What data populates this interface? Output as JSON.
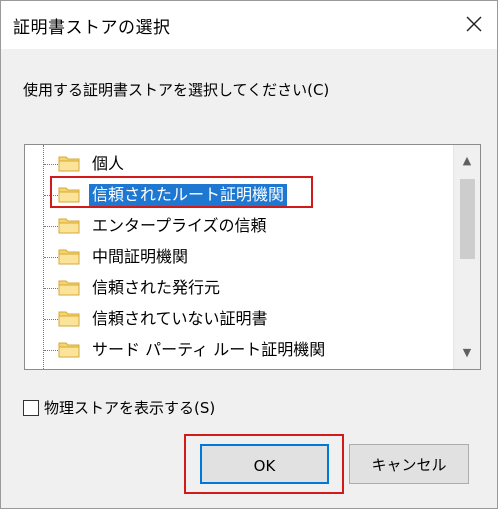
{
  "window": {
    "title": "証明書ストアの選択"
  },
  "prompt": "使用する証明書ストアを選択してください(C)",
  "stores": [
    {
      "label": "個人",
      "selected": false
    },
    {
      "label": "信頼されたルート証明機関",
      "selected": true
    },
    {
      "label": "エンタープライズの信頼",
      "selected": false
    },
    {
      "label": "中間証明機関",
      "selected": false
    },
    {
      "label": "信頼された発行元",
      "selected": false
    },
    {
      "label": "信頼されていない証明書",
      "selected": false
    },
    {
      "label": "サード パーティ ルート証明機関",
      "selected": false
    }
  ],
  "scroll": {
    "up": "▲",
    "down": "▼"
  },
  "show_physical": {
    "label": "物理ストアを表示する(S)",
    "checked": false
  },
  "buttons": {
    "ok": "OK",
    "cancel": "キャンセル"
  },
  "colors": {
    "selection": "#1e78d2",
    "highlight_box": "#d11a1a",
    "folder": "#f7d56b"
  }
}
